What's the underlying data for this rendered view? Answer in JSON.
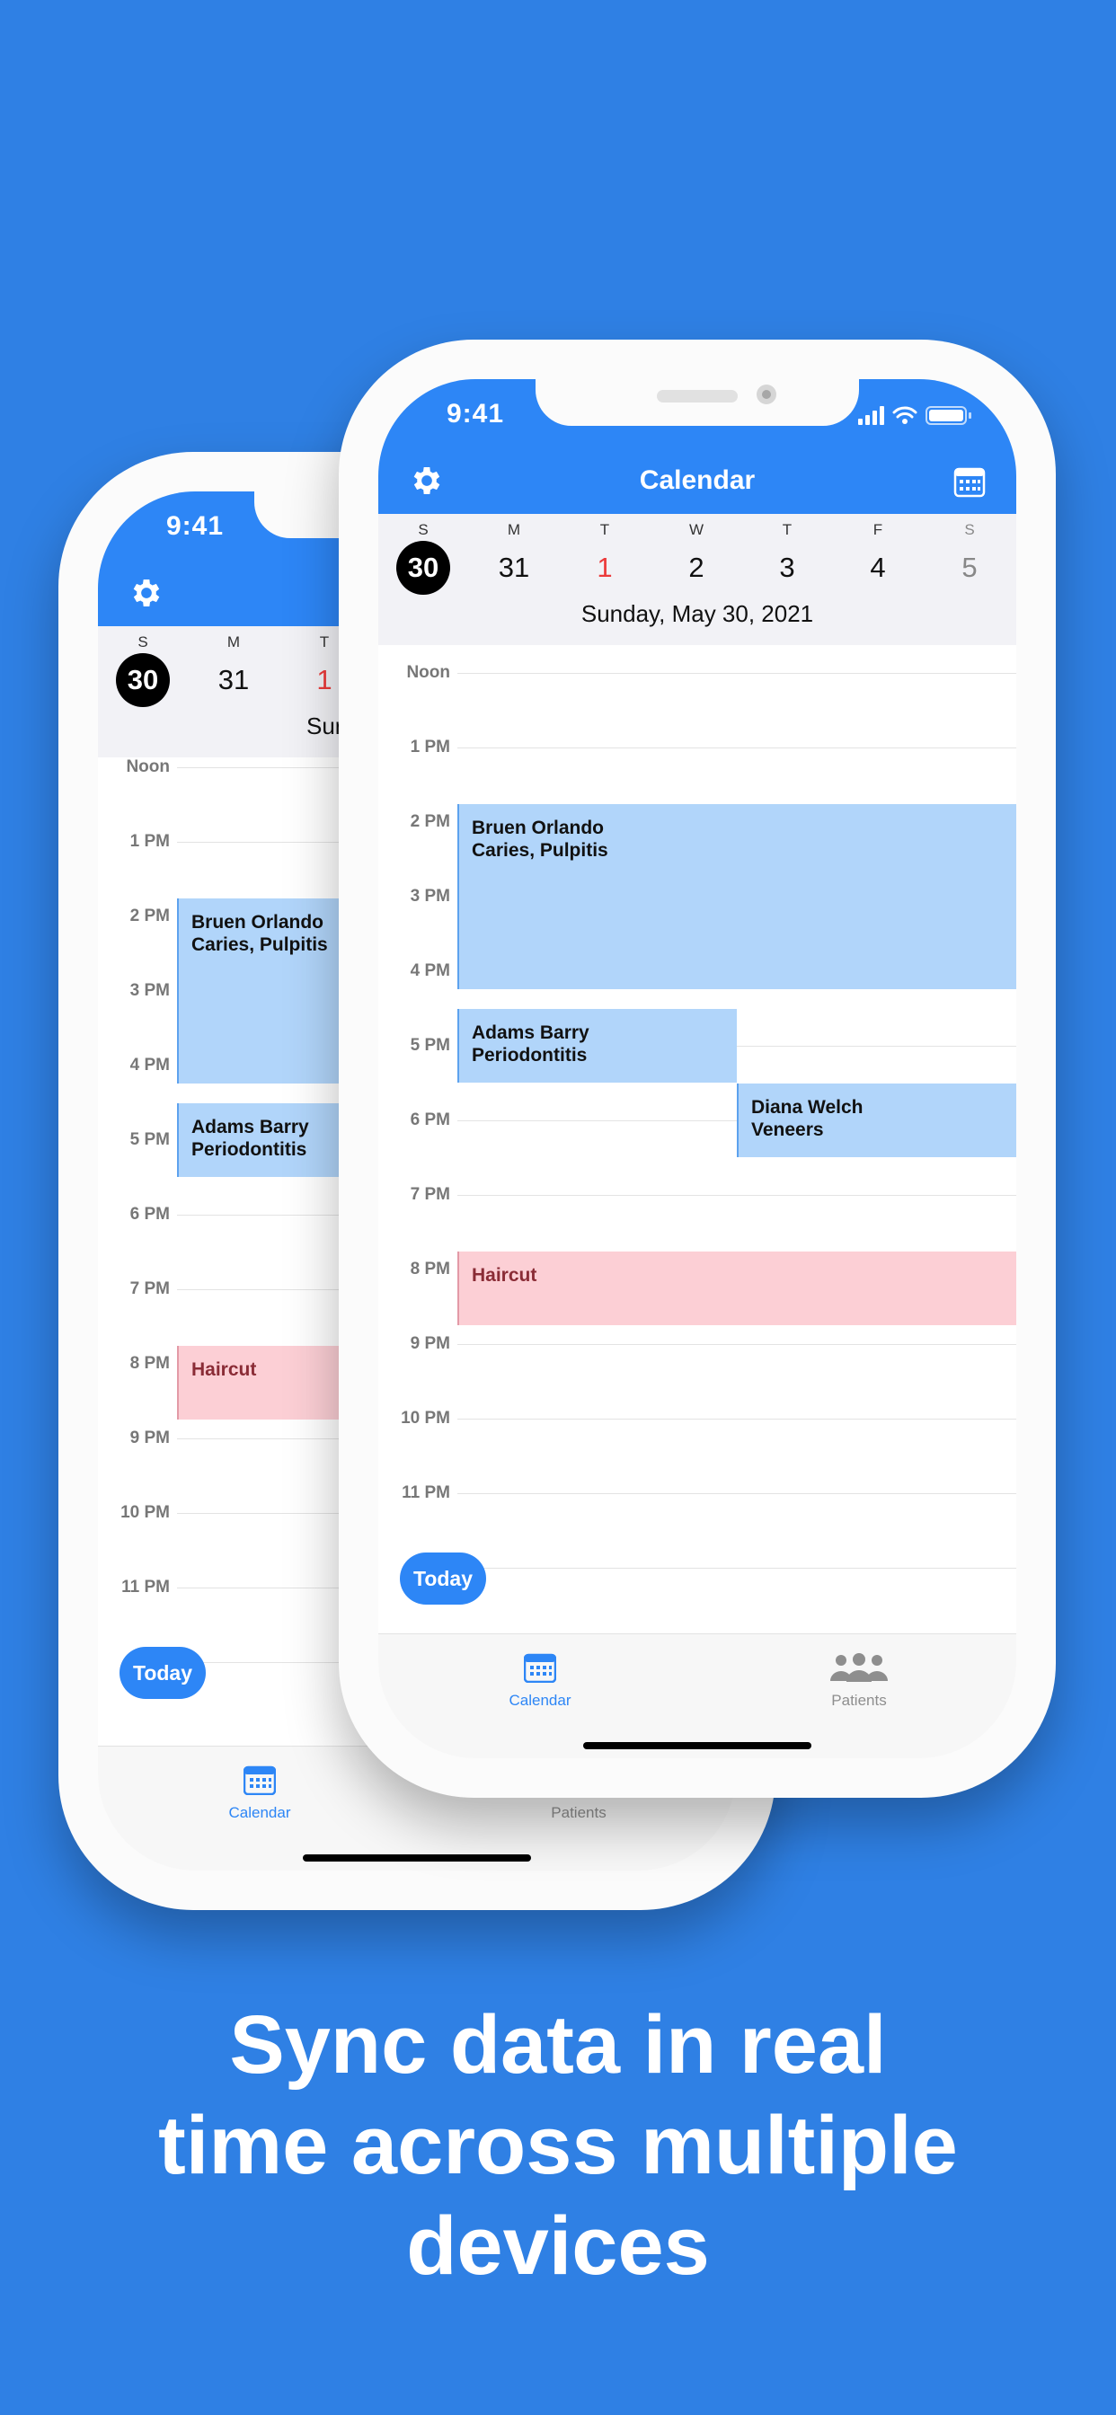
{
  "status": {
    "time": "9:41"
  },
  "header": {
    "title": "Calendar"
  },
  "week": {
    "days": [
      {
        "letter": "S",
        "num": "30",
        "state": "selected"
      },
      {
        "letter": "M",
        "num": "31",
        "state": "normal"
      },
      {
        "letter": "T",
        "num": "1",
        "state": "today"
      },
      {
        "letter": "W",
        "num": "2",
        "state": "normal"
      },
      {
        "letter": "T",
        "num": "3",
        "state": "normal"
      },
      {
        "letter": "F",
        "num": "4",
        "state": "normal"
      },
      {
        "letter": "S",
        "num": "5",
        "state": "muted"
      }
    ],
    "selected_date": "Sunday, May 30, 2021",
    "back_partial_date": "Sur"
  },
  "hours": [
    "Noon",
    "1 PM",
    "2 PM",
    "3 PM",
    "4 PM",
    "5 PM",
    "6 PM",
    "7 PM",
    "8 PM",
    "9 PM",
    "10 PM",
    "11 PM"
  ],
  "events": {
    "bruen": {
      "name": "Bruen Orlando",
      "detail": "Caries, Pulpitis"
    },
    "adams": {
      "name": "Adams Barry",
      "detail": "Periodontitis"
    },
    "diana": {
      "name": "Diana Welch",
      "detail": "Veneers"
    },
    "haircut": {
      "name": "Haircut"
    }
  },
  "today_label": "Today",
  "tabs": {
    "calendar": "Calendar",
    "patients": "Patients"
  },
  "caption": [
    "Sync data in real",
    "time across multiple",
    "devices"
  ],
  "colors": {
    "background": "#2f80e4",
    "accent": "#2d86f6",
    "event_blue": "#b1d5fa",
    "event_pink": "#fccfd5",
    "today_red": "#ec3b3b"
  }
}
